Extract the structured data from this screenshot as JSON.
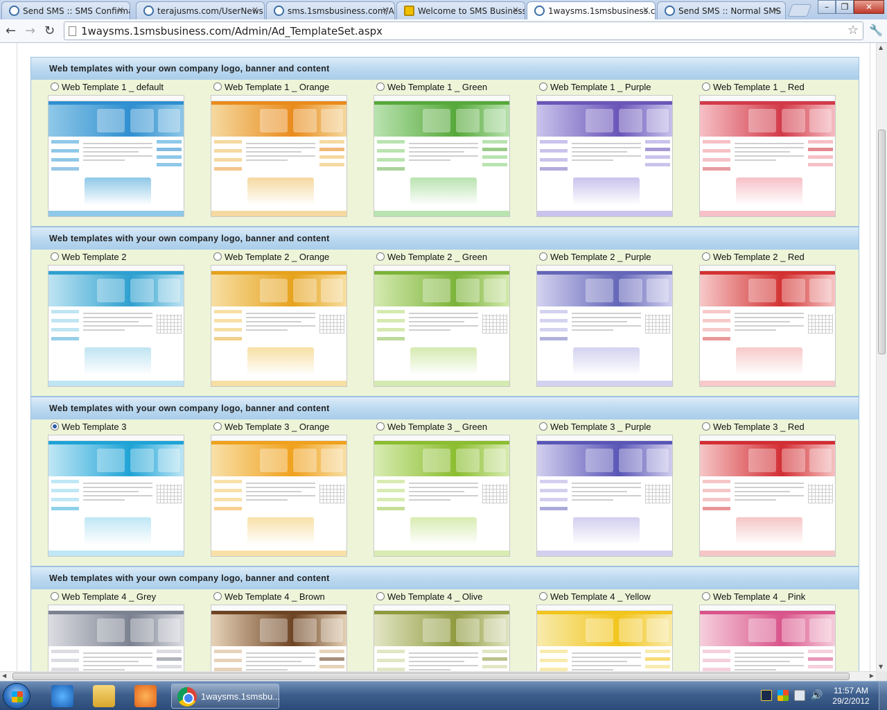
{
  "browser": {
    "tabs": [
      {
        "title": "Send SMS :: SMS Confirma",
        "favicon": "globe-icon"
      },
      {
        "title": "terajusms.com/UserNews.",
        "favicon": "globe-icon"
      },
      {
        "title": "sms.1smsbusiness.com/A",
        "favicon": "globe-icon"
      },
      {
        "title": "Welcome to SMS Business",
        "favicon": "sms-logo-icon"
      },
      {
        "title": "1waysms.1smsbusiness.co",
        "favicon": "globe-icon",
        "active": true
      },
      {
        "title": "Send SMS :: Normal SMS",
        "favicon": "globe-icon"
      }
    ],
    "tab_close_glyph": "×",
    "url": "1waysms.1smsbusiness.com/Admin/Ad_TemplateSet.aspx"
  },
  "sections": [
    {
      "heading": "Web templates with your own company logo, banner and content",
      "options": [
        {
          "label": "Web Template 1 _ default",
          "checked": false,
          "color": "#8fc8e8",
          "accent": "#2f8fd0"
        },
        {
          "label": "Web Template 1 _ Orange",
          "checked": false,
          "color": "#f5d9a0",
          "accent": "#e98b1c"
        },
        {
          "label": "Web Template 1 _ Green",
          "checked": false,
          "color": "#b9e3b0",
          "accent": "#56a83a"
        },
        {
          "label": "Web Template 1 _ Purple",
          "checked": false,
          "color": "#c9c3ec",
          "accent": "#6a55b8"
        },
        {
          "label": "Web Template 1 _ Red",
          "checked": false,
          "color": "#f6c0c6",
          "accent": "#d23a48"
        }
      ]
    },
    {
      "heading": "Web templates with your own company logo, banner and content",
      "options": [
        {
          "label": "Web Template 2",
          "checked": false,
          "color": "#bfe4f2",
          "accent": "#2ea0cf"
        },
        {
          "label": "Web Template 2 _ Orange",
          "checked": false,
          "color": "#f7dfa4",
          "accent": "#e6a21c"
        },
        {
          "label": "Web Template 2 _ Green",
          "checked": false,
          "color": "#d5eab0",
          "accent": "#7bb338"
        },
        {
          "label": "Web Template 2 _ Purple",
          "checked": false,
          "color": "#d3d2f0",
          "accent": "#6466b8"
        },
        {
          "label": "Web Template 2 _ Red",
          "checked": false,
          "color": "#f7c9c9",
          "accent": "#d33131"
        }
      ]
    },
    {
      "heading": "Web templates with your own company logo, banner and content",
      "options": [
        {
          "label": "Web Template 3",
          "checked": true,
          "color": "#bfe7f5",
          "accent": "#1ea3d6"
        },
        {
          "label": "Web Template 3 _ Orange",
          "checked": false,
          "color": "#f8e0a8",
          "accent": "#f0a11d"
        },
        {
          "label": "Web Template 3 _ Green",
          "checked": false,
          "color": "#d8ecb2",
          "accent": "#8bbd2f"
        },
        {
          "label": "Web Template 3 _ Purple",
          "checked": false,
          "color": "#d2cfef",
          "accent": "#5a56b6"
        },
        {
          "label": "Web Template 3 _ Red",
          "checked": false,
          "color": "#f6c6c6",
          "accent": "#d22e34"
        }
      ]
    },
    {
      "heading": "Web templates with your own company logo, banner and content",
      "options": [
        {
          "label": "Web Template 4 _ Grey",
          "checked": false,
          "color": "#dcdde2",
          "accent": "#7b8190"
        },
        {
          "label": "Web Template 4 _ Brown",
          "checked": false,
          "color": "#e7d3b9",
          "accent": "#6d4423"
        },
        {
          "label": "Web Template 4 _ Olive",
          "checked": false,
          "color": "#e3e6c5",
          "accent": "#8f9a3e"
        },
        {
          "label": "Web Template 4 _ Yellow",
          "checked": false,
          "color": "#f8ebad",
          "accent": "#f2c51c"
        },
        {
          "label": "Web Template 4 _ Pink",
          "checked": false,
          "color": "#f6cfdc",
          "accent": "#d9548a"
        }
      ]
    }
  ],
  "taskbar": {
    "active_task": "1waysms.1smsbu...",
    "time": "11:57 AM",
    "date": "29/2/2012"
  }
}
